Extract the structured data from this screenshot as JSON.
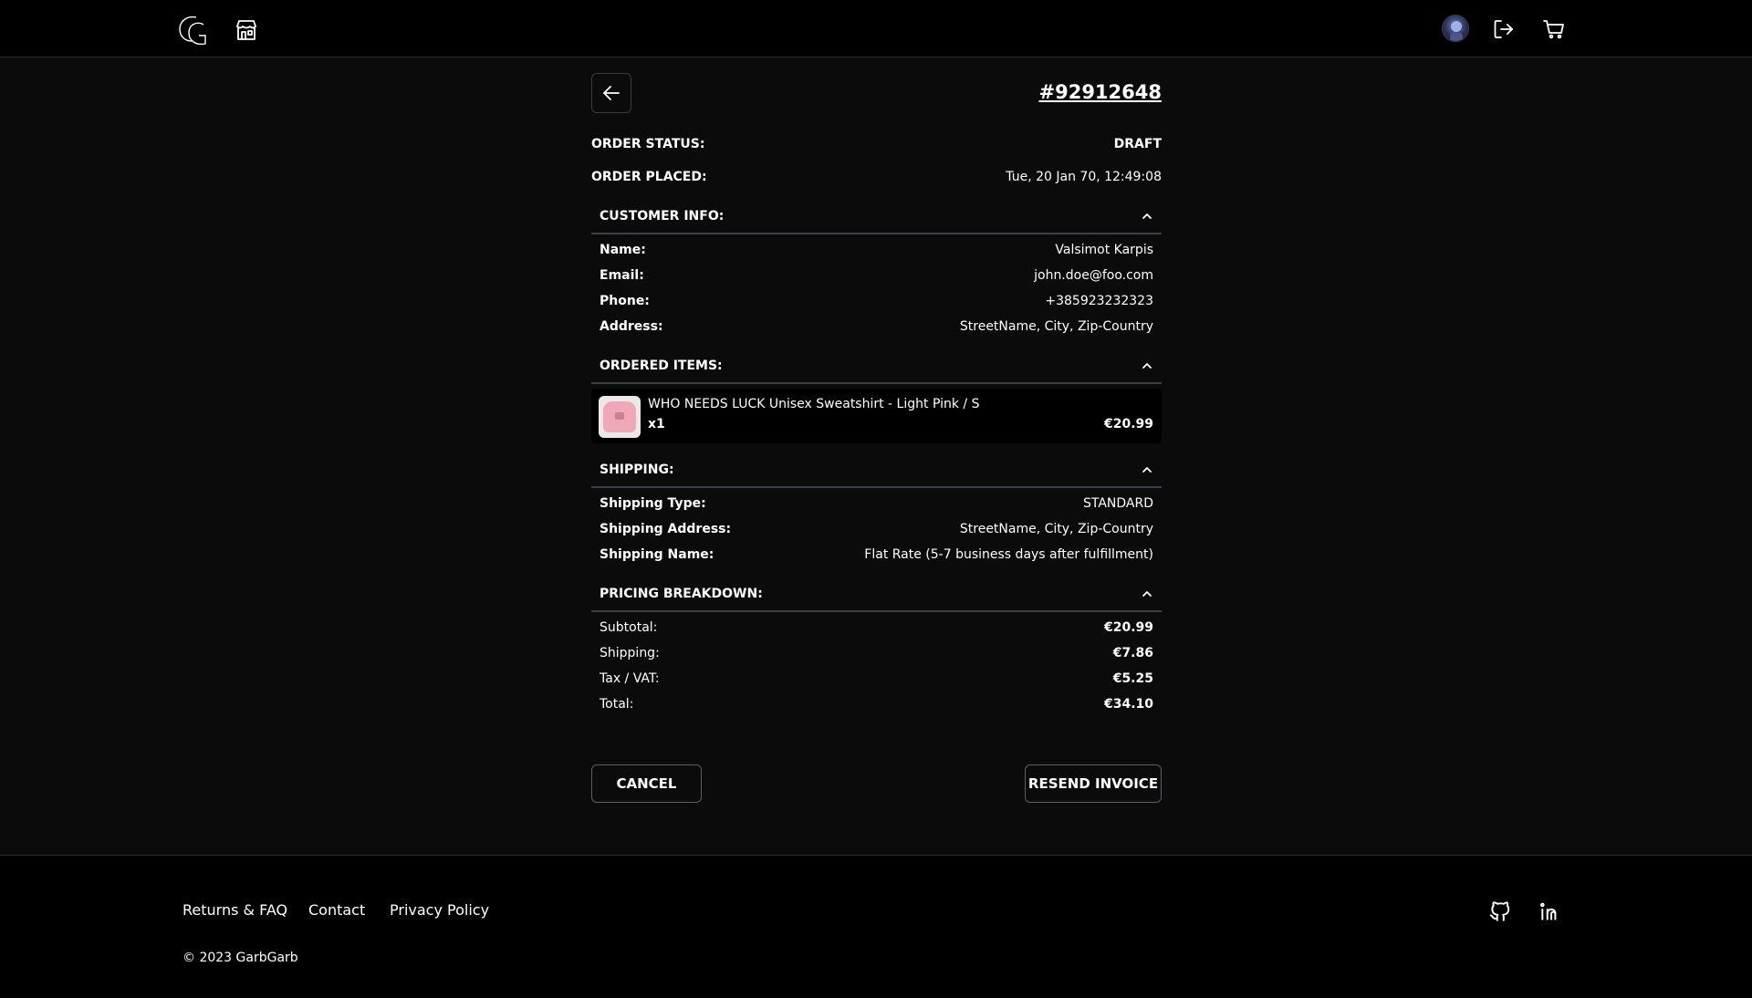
{
  "header": {
    "logo_icon": "gg-monogram-logo-icon",
    "shop_icon": "storefront-icon",
    "avatar_icon": "user-avatar",
    "logout_icon": "logout-icon",
    "cart_icon": "cart-icon"
  },
  "order": {
    "back_icon": "arrow-left-icon",
    "id": "#92912648",
    "status_label": "ORDER STATUS:",
    "status_value": "DRAFT",
    "placed_label": "ORDER PLACED:",
    "placed_value": "Tue, 20 Jan 70, 12:49:08"
  },
  "customer": {
    "title": "CUSTOMER INFO:",
    "rows": [
      {
        "label": "Name:",
        "value": "Valsimot Karpis"
      },
      {
        "label": "Email:",
        "value": "john.doe@foo.com"
      },
      {
        "label": "Phone:",
        "value": "+385923232323"
      },
      {
        "label": "Address:",
        "value": "StreetName, City, Zip-Country"
      }
    ]
  },
  "items": {
    "title": "ORDERED ITEMS:",
    "list": [
      {
        "name": "WHO NEEDS LUCK Unisex Sweatshirt - Light Pink / S",
        "qty": "x1",
        "price": "€20.99"
      }
    ]
  },
  "shipping": {
    "title": "SHIPPING:",
    "rows": [
      {
        "label": "Shipping Type:",
        "value": "STANDARD"
      },
      {
        "label": "Shipping Address:",
        "value": "StreetName, City, Zip-Country"
      },
      {
        "label": "Shipping Name:",
        "value": "Flat Rate (5-7 business days after fulfillment)"
      }
    ]
  },
  "pricing": {
    "title": "PRICING BREAKDOWN:",
    "rows": [
      {
        "label": "Subtotal:",
        "value": "€20.99"
      },
      {
        "label": "Shipping:",
        "value": "€7.86"
      },
      {
        "label": "Tax / VAT:",
        "value": "€5.25"
      },
      {
        "label": "Total:",
        "value": "€34.10"
      }
    ]
  },
  "actions": {
    "cancel_label": "CANCEL",
    "resend_label": "RESEND INVOICE"
  },
  "footer": {
    "links": [
      "Returns & FAQ",
      "Contact",
      "Privacy Policy"
    ],
    "copyright": "© 2023 GarbGarb",
    "github_icon": "github-icon",
    "linkedin_icon": "linkedin-icon"
  },
  "colors": {
    "background": "#0b0b0c",
    "bar": "#000000",
    "text": "#ffffff",
    "border": "#3a3f4a"
  }
}
